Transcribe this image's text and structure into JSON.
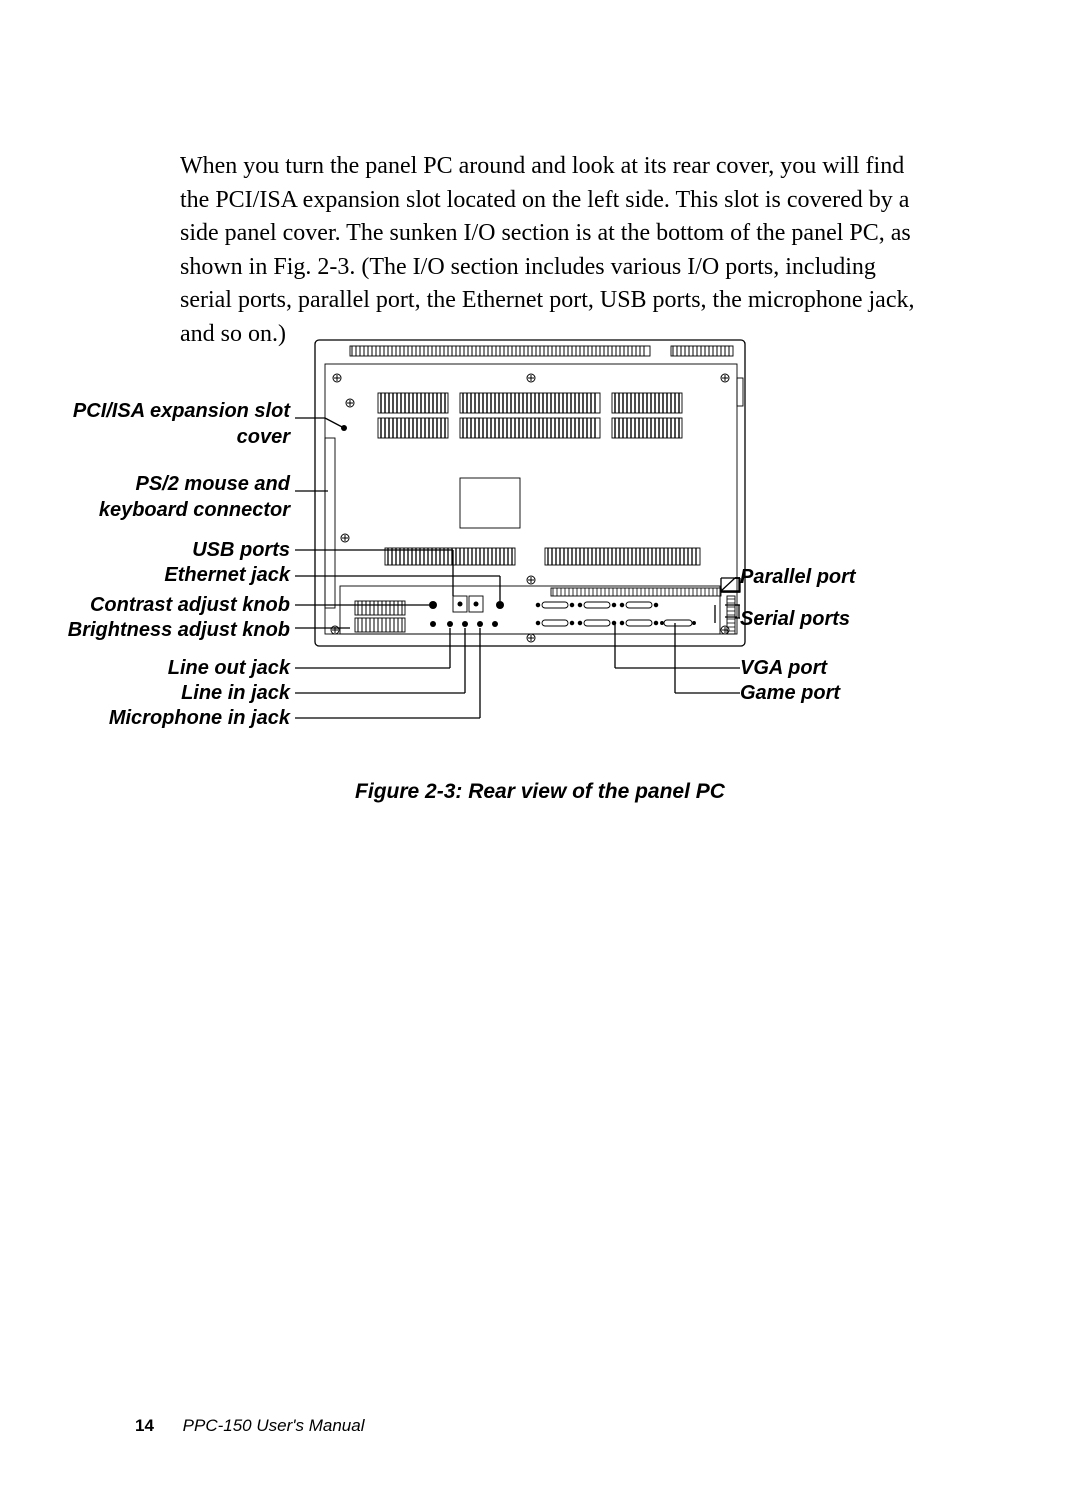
{
  "paragraph": "When you turn the panel PC around and look at its rear cover, you will find the PCI/ISA expansion slot located on the left side. This slot is covered by a side panel cover. The sunken I/O section is at the bottom of the panel PC, as shown in Fig. 2-3. (The I/O section includes various I/O ports, including serial ports, parallel port, the Ethernet port, USB ports, the microphone jack, and so on.)",
  "labels": {
    "left": {
      "pci_isa": "PCI/ISA expansion slot cover",
      "ps2": "PS/2 mouse and keyboard connector",
      "usb": "USB ports",
      "ethernet": "Ethernet jack",
      "contrast": "Contrast adjust knob",
      "brightness": "Brightness adjust knob",
      "lineout": "Line out jack",
      "linein": "Line in jack",
      "mic": "Microphone in jack"
    },
    "right": {
      "parallel": "Parallel port",
      "serial": "Serial ports",
      "vga": "VGA port",
      "game": "Game port"
    }
  },
  "caption": "Figure 2-3: Rear view of the panel PC",
  "footer": {
    "page": "14",
    "title": "PPC-150 User's Manual"
  }
}
